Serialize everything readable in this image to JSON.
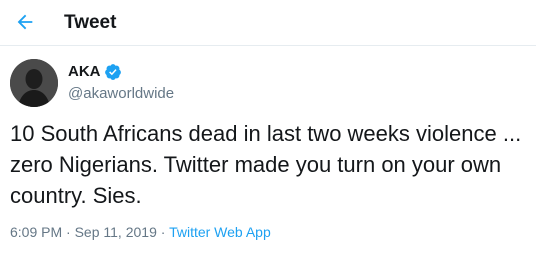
{
  "header": {
    "back_icon": "arrow-left-icon",
    "title": "Tweet"
  },
  "tweet": {
    "author": {
      "name": "AKA",
      "handle": "@akaworldwide",
      "verified_icon": "verified-badge-icon"
    },
    "text": "10 South Africans dead in last two weeks violence ...\nzero Nigerians. Twitter made you turn on your own\ncountry. Sies.",
    "time": "6:09 PM",
    "separator": "·",
    "date": "Sep 11, 2019",
    "source": "Twitter Web App"
  },
  "colors": {
    "accent": "#1da1f2",
    "text_primary": "#14171a",
    "text_secondary": "#657786",
    "divider": "#e6ecf0"
  }
}
